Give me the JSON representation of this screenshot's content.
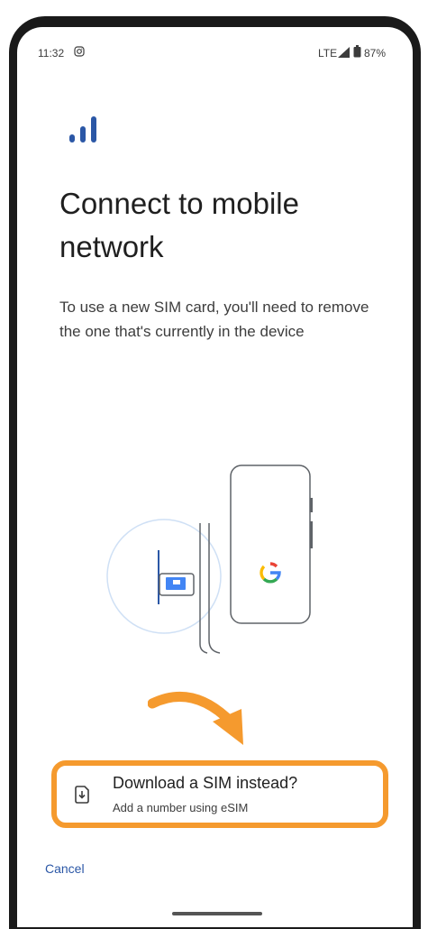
{
  "status_bar": {
    "time": "11:32",
    "network": "LTE",
    "battery": "87%",
    "icons": [
      "instagram-notification-icon",
      "signal-strength-icon",
      "battery-icon"
    ]
  },
  "header": {
    "icon": "signal-bars-icon",
    "title": "Connect to mobile network"
  },
  "body": {
    "text": "To use a new SIM card, you'll need to remove the one that's currently in the device"
  },
  "illustration": {
    "description_icon": "sim-swap-illustration",
    "logo_letter": "G"
  },
  "esim_option": {
    "title": "Download a SIM instead?",
    "subtitle": "Add a number using eSIM",
    "icon": "esim-download-icon",
    "highlight_color": "#f59a2e"
  },
  "actions": {
    "cancel_label": "Cancel"
  },
  "colors": {
    "accent": "#2b57a6",
    "highlight": "#f59a2e"
  }
}
